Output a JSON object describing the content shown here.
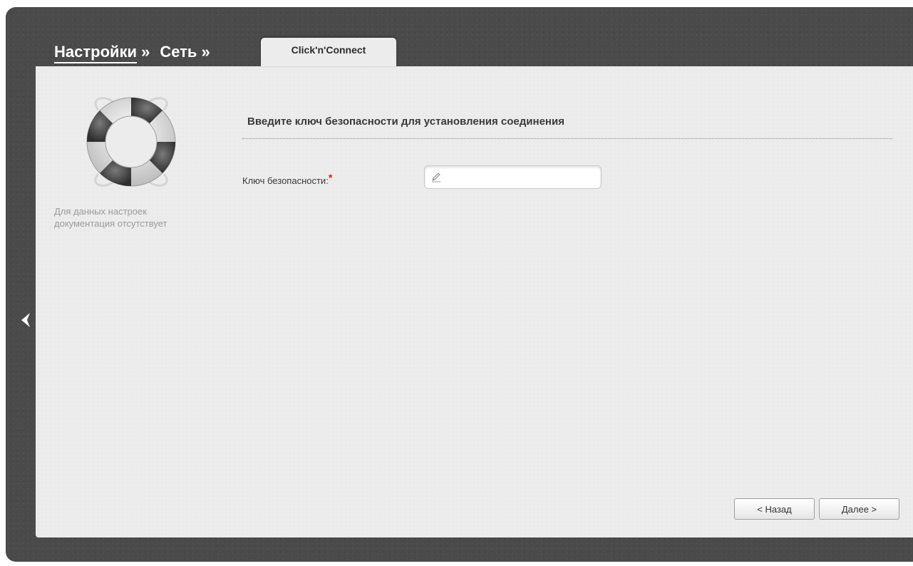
{
  "breadcrumb": {
    "items": [
      {
        "label": "Настройки"
      },
      {
        "label": "Сеть"
      }
    ],
    "separator": "»",
    "active_tab": "Click'n'Connect"
  },
  "help": {
    "icon": "lifebuoy-icon",
    "text": "Для данных настроек документация отсутствует"
  },
  "form": {
    "section_title": "Введите ключ безопасности для установления соединения",
    "security_key": {
      "label": "Ключ безопасности:",
      "required_mark": "*",
      "value": "",
      "icon": "pencil-icon"
    }
  },
  "buttons": {
    "back_label": "< Назад",
    "next_label": "Далее >"
  },
  "nav": {
    "collapse_icon": "chevron-left-icon"
  },
  "colors": {
    "frame": "#4a4a4a",
    "panel": "#ececec",
    "required": "#d0201a"
  }
}
